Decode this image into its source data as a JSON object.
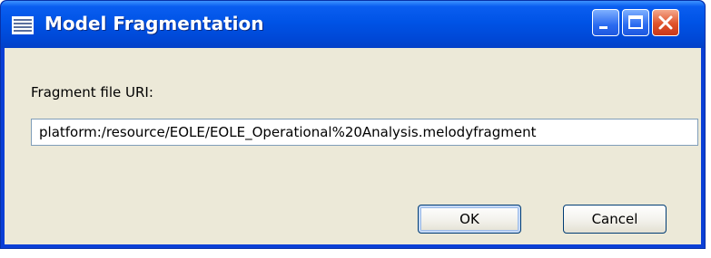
{
  "window": {
    "title": "Model Fragmentation",
    "title_icon": "dialog-menu-icon",
    "controls": [
      "minimize-icon",
      "maximize-icon",
      "close-icon"
    ]
  },
  "form": {
    "label": "Fragment file URI:",
    "uri_value": "platform:/resource/EOLE/EOLE_Operational%20Analysis.melodyfragment"
  },
  "buttons": {
    "ok_label": "OK",
    "cancel_label": "Cancel"
  },
  "colors": {
    "titlebar": "#0053e6",
    "client_background": "#ece9d8",
    "close_button": "#e0522a"
  }
}
